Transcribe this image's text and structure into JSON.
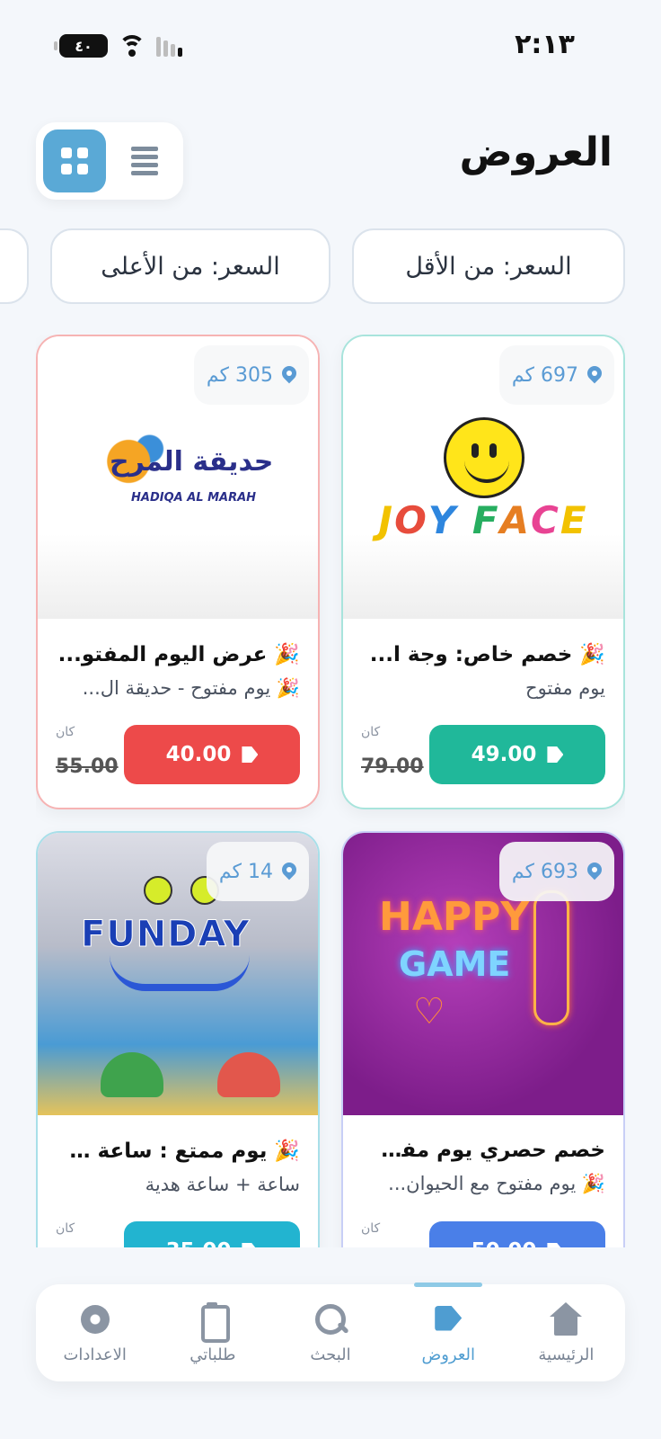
{
  "status_bar": {
    "time": "٢:١٣",
    "battery": "٤٠"
  },
  "header": {
    "title": "العروض"
  },
  "view_toggle": {
    "active": "grid"
  },
  "sort_chips": [
    {
      "label": "السعر: من الأقل"
    },
    {
      "label": "السعر: من الأعلى"
    }
  ],
  "offers": [
    {
      "distance": "697 كم",
      "brand": "JOY FACE",
      "title": "🎉 خصم خاص: وجة ا...",
      "subtitle": "يوم مفتوح",
      "price": "49.00",
      "was_label": "كان",
      "old_price": "79.00",
      "accent": "#20b89a"
    },
    {
      "distance": "305 كم",
      "brand_ar": "حديقة المرح",
      "brand_en": "HADIQA AL MARAH",
      "title": "🎉 عرض اليوم المفتو...",
      "subtitle": "🎉 يوم مفتوح - حديقة ال...",
      "price": "40.00",
      "was_label": "كان",
      "old_price": "55.00",
      "accent": "#ed4a4a"
    },
    {
      "distance": "693 كم",
      "brand_line1": "HAPPY",
      "brand_line2": "GAME",
      "title": "خصم حصري يوم مفت...",
      "subtitle": "🎉 يوم مفتوح مع الحيوان...",
      "price": "50.00",
      "was_label": "كان",
      "accent": "#4a7fe8"
    },
    {
      "distance": "14 كم",
      "brand": "FUNDAY",
      "title": "🎉 يوم ممتع : ساعة ل...",
      "subtitle": "ساعة + ساعة هدية",
      "price": "35.00",
      "was_label": "كان",
      "accent": "#22b4d0"
    }
  ],
  "bottom_nav": [
    {
      "label": "الرئيسية",
      "icon": "home-icon",
      "active": false
    },
    {
      "label": "العروض",
      "icon": "tags-icon",
      "active": true
    },
    {
      "label": "البحث",
      "icon": "search-icon",
      "active": false
    },
    {
      "label": "طلباتي",
      "icon": "clipboard-icon",
      "active": false
    },
    {
      "label": "الاعدادات",
      "icon": "gear-icon",
      "active": false
    }
  ]
}
